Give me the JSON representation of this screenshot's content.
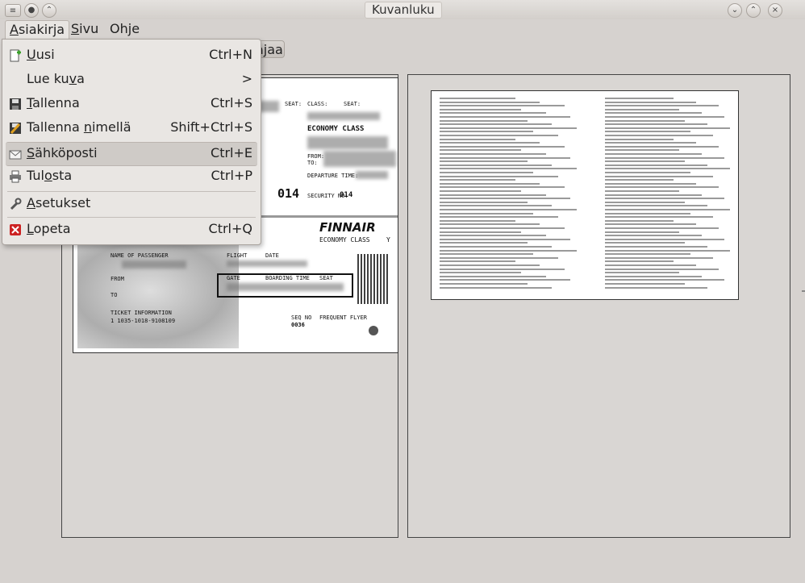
{
  "window": {
    "title": "Kuvanluku"
  },
  "menubar": {
    "items": [
      {
        "label": "Asiakirja",
        "mnemonic": "A",
        "rest": "siakirja"
      },
      {
        "label": "Sivu",
        "mnemonic": "S",
        "rest": "ivu"
      },
      {
        "label": "Ohje",
        "pre": "Oh",
        "mnemonic": "j",
        "rest": "e"
      }
    ]
  },
  "toolbar": {
    "partial_button_text": "ajaa"
  },
  "file_menu": {
    "items": [
      {
        "pre": "",
        "u": "U",
        "post": "usi",
        "shortcut": "Ctrl+N",
        "icon": "new-document-icon"
      },
      {
        "pre": "Lue ku",
        "u": "v",
        "post": "a",
        "shortcut": ">",
        "icon": ""
      },
      {
        "pre": "",
        "u": "T",
        "post": "allenna",
        "shortcut": "Ctrl+S",
        "icon": "save-icon"
      },
      {
        "pre": "Tallenna ",
        "u": "n",
        "post": "imellä",
        "shortcut": "Shift+Ctrl+S",
        "icon": "save-as-icon"
      },
      {
        "pre": "",
        "u": "S",
        "post": "ähköposti",
        "shortcut": "Ctrl+E",
        "icon": "email-icon"
      },
      {
        "pre": "Tul",
        "u": "o",
        "post": "sta",
        "shortcut": "Ctrl+P",
        "icon": "print-icon"
      },
      {
        "pre": "",
        "u": "A",
        "post": "setukset",
        "shortcut": "",
        "icon": "settings-icon"
      },
      {
        "pre": "",
        "u": "L",
        "post": "opeta",
        "shortcut": "Ctrl+Q",
        "icon": "quit-icon"
      }
    ]
  },
  "page1": {
    "labels": {
      "seat": "SEAT:",
      "class": "CLASS:",
      "seat2": "SEAT:",
      "economy": "ECONOMY CLASS",
      "from": "FROM:",
      "to": "TO:",
      "departure": "DEPARTURE TIME:",
      "num_big": "014",
      "security": "SECURITY NO:",
      "num_small": "014",
      "airline": "FINNAIR",
      "economy2": "ECONOMY CLASS",
      "y": "Y",
      "name_of_passenger": "NAME OF PASSENGER",
      "flight": "FLIGHT",
      "date": "DATE",
      "from2": "FROM",
      "to2": "TO",
      "gate": "GATE",
      "boarding": "BOARDING TIME",
      "seat3": "SEAT",
      "ticket": "TICKET INFORMATION",
      "ticket_no": "1  1035-1018-9108109",
      "seq": "SEQ NO",
      "seq_val": "0036",
      "ff": "FREQUENT FLYER"
    }
  },
  "colors": {
    "accent_close": "#cc2222",
    "new_icon_green": "#3aa02a"
  }
}
